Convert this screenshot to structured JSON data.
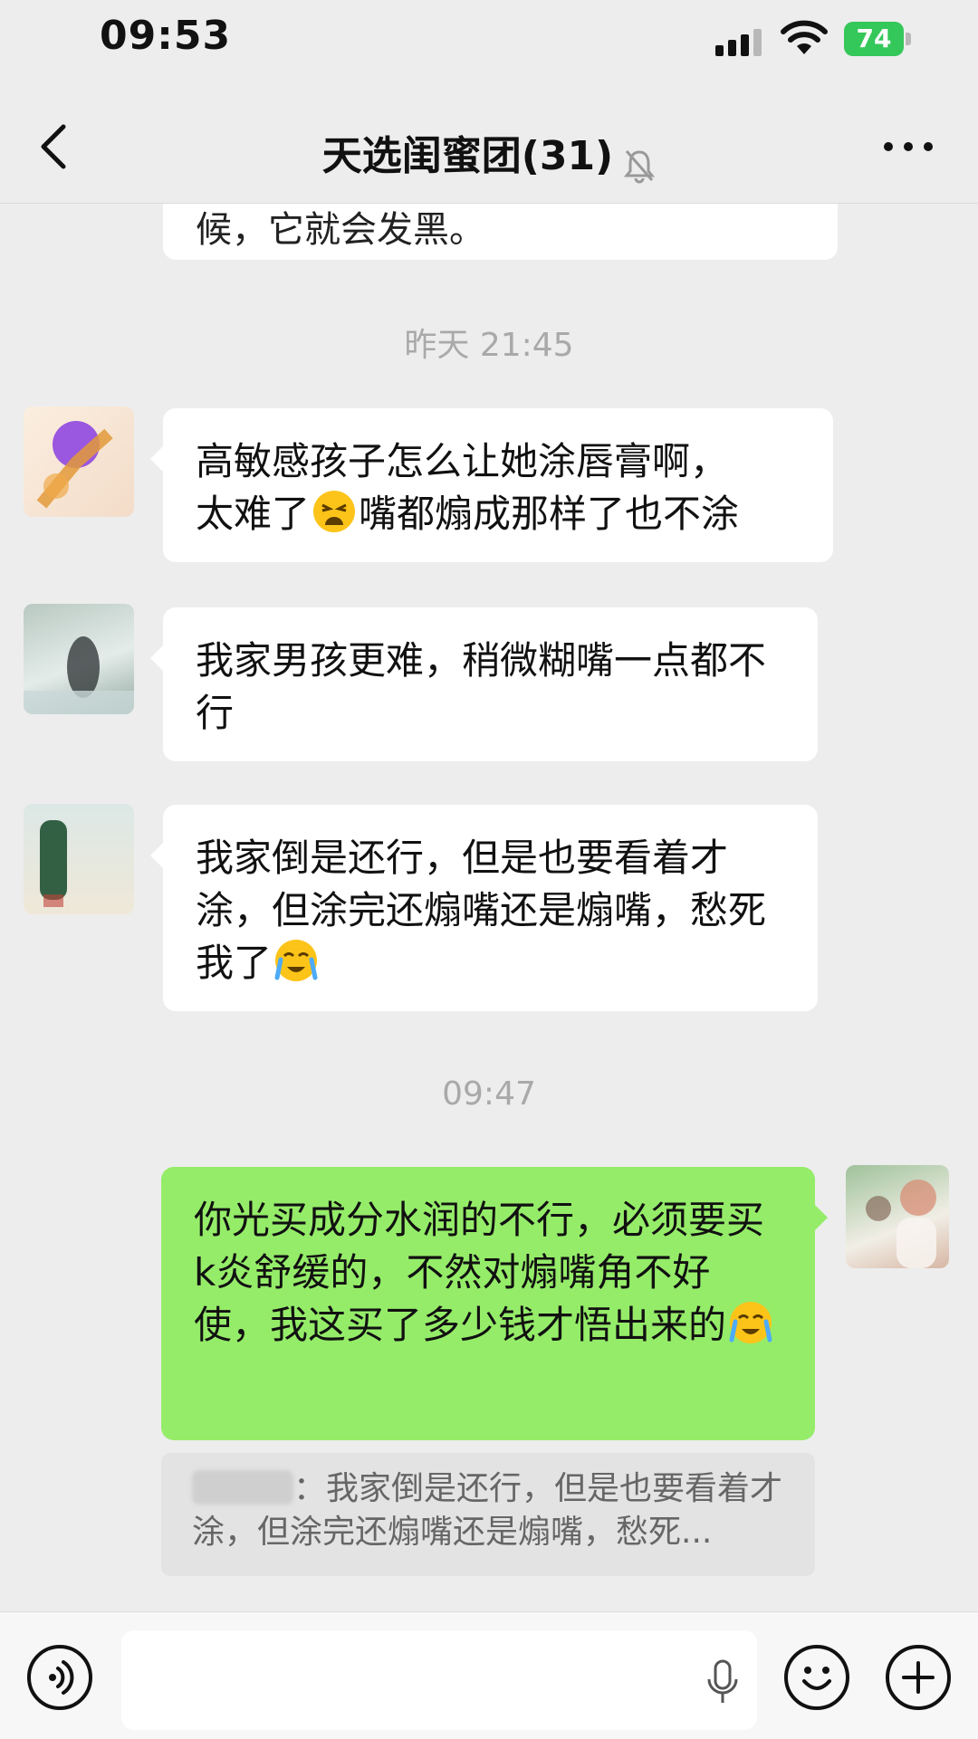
{
  "status_bar": {
    "time": "09:53",
    "battery": "74"
  },
  "nav": {
    "title": "天选闺蜜团(31)",
    "back_icon": "chevron-left-icon",
    "mute_icon": "bell-slash-icon",
    "more_icon": "ellipsis-icon"
  },
  "messages": {
    "partial_text": "候，它就会发黑。",
    "timestamp_1": "昨天 21:45",
    "msg1": {
      "line1": "高敏感孩子怎么让她涂唇膏啊，",
      "line2a": "太难了",
      "line2b": "嘴都煽成那样了也不涂"
    },
    "msg2": {
      "text": "我家男孩更难，稍微糊嘴一点都不行"
    },
    "msg3": {
      "text": "我家倒是还行，但是也要看着才涂，但涂完还煽嘴还是煽嘴，愁死我了"
    },
    "timestamp_2": "09:47",
    "msg4": {
      "text": "你光买成分水润的不行，必须要买k炎舒缓的，不然对煽嘴角不好使，我这买了多少钱才悟出来的"
    },
    "quote": {
      "text": "：我家倒是还行，但是也要看着才涂，但涂完还煽嘴还是煽嘴，愁死..."
    }
  },
  "input_bar": {
    "voice_icon": "voice-mode-icon",
    "mic_icon": "microphone-icon",
    "emoji_icon": "smiley-icon",
    "plus_icon": "plus-icon"
  },
  "colors": {
    "background": "#ededed",
    "self_bubble": "#95ec69",
    "other_bubble": "#ffffff",
    "battery": "#34c759"
  }
}
